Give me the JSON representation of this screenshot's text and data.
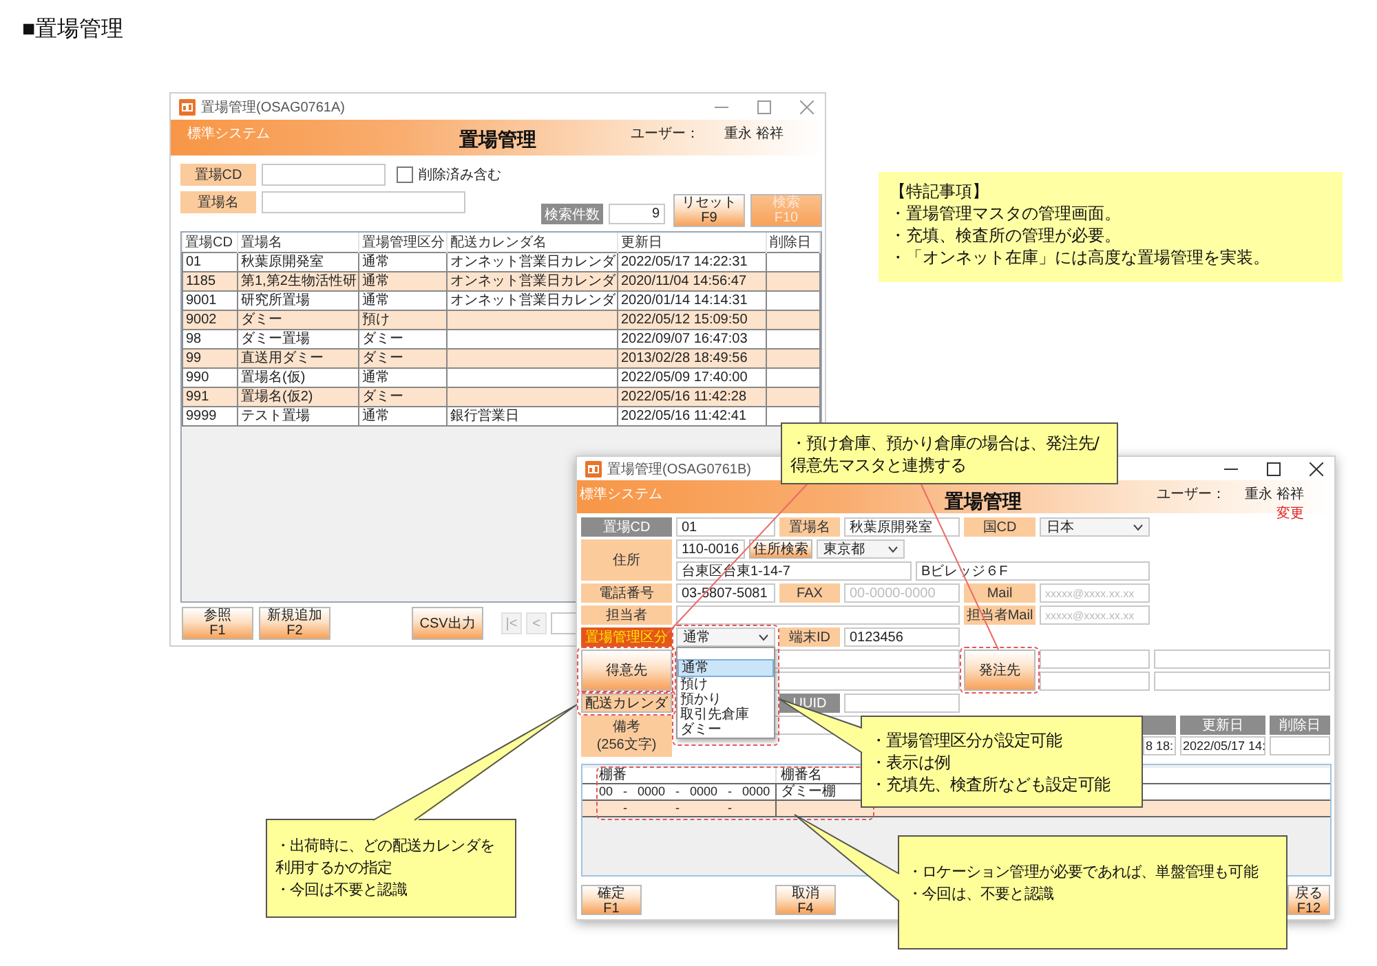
{
  "page_title": "■置場管理",
  "list_window": {
    "title": "置場管理(OSAG0761A)",
    "system": "標準システム",
    "heading": "置場管理",
    "user_label": "ユーザー：",
    "user_name": "重永 裕祥",
    "search_fields": [
      {
        "label": "置場CD"
      },
      {
        "label": "置場名"
      }
    ],
    "include_deleted": {
      "label": "削除済み含む",
      "checked": false
    },
    "count": {
      "label": "検索件数",
      "value": "9"
    },
    "buttons": [
      {
        "label": "リセット",
        "key": "F9",
        "disabled": false
      },
      {
        "label": "検索",
        "key": "F10",
        "disabled": true
      }
    ],
    "table": {
      "columns": [
        "置場CD",
        "置場名",
        "置場管理区分",
        "配送カレンダ名",
        "更新日",
        "削除日"
      ],
      "rows": [
        {
          "cells": [
            "01",
            "秋葉原開発室",
            "通常",
            "オンネット営業日カレンダ",
            "2022/05/17 14:22:31",
            null
          ]
        },
        {
          "cells": [
            "1185",
            "第1,第2生物活性研",
            "通常",
            "オンネット営業日カレンダ",
            "2020/11/04 14:56:47",
            null
          ]
        },
        {
          "cells": [
            "9001",
            "研究所置場",
            "通常",
            "オンネット営業日カレンダ",
            "2020/01/14 14:14:31",
            null
          ]
        },
        {
          "cells": [
            "9002",
            "ダミー",
            "預け",
            null,
            "2022/05/12 15:09:50",
            null
          ]
        },
        {
          "cells": [
            "98",
            "ダミー置場",
            "ダミー",
            null,
            "2022/09/07 16:47:03",
            null
          ]
        },
        {
          "cells": [
            "99",
            "直送用ダミー",
            "ダミー",
            null,
            "2013/02/28 18:49:56",
            null
          ]
        },
        {
          "cells": [
            "990",
            "置場名(仮)",
            "通常",
            null,
            "2022/05/09 17:40:00",
            null
          ]
        },
        {
          "cells": [
            "991",
            "置場名(仮2)",
            "ダミー",
            null,
            "2022/05/16 11:42:28",
            null
          ]
        },
        {
          "cells": [
            "9999",
            "テスト置場",
            "通常",
            "銀行営業日",
            "2022/05/16 11:42:41",
            null
          ]
        }
      ]
    },
    "footer_buttons": [
      {
        "label": "参照",
        "key": "F1"
      },
      {
        "label": "新規追加",
        "key": "F2"
      },
      {
        "label": "CSV出力"
      }
    ],
    "pager": [
      "|<",
      "<"
    ]
  },
  "detail_window": {
    "title": "置場管理(OSAG0761B)",
    "system": "標準システム",
    "heading": "置場管理",
    "user_label": "ユーザー：",
    "user_name": "重永 裕祥",
    "mode": "変更",
    "code": {
      "label": "置場CD",
      "value": "01"
    },
    "name": {
      "label": "置場名",
      "value": "秋葉原開発室"
    },
    "country": {
      "label": "国CD",
      "value": "日本"
    },
    "address": {
      "label": "住所",
      "postal": "110-0016",
      "search_button": "住所検索",
      "prefecture": "東京都",
      "line1": "台東区台東1-14-7",
      "line2": "Bビレッジ６F"
    },
    "phone": {
      "label": "電話番号",
      "value": "03-5807-5081"
    },
    "fax": {
      "label": "FAX",
      "placeholder": "00-0000-0000"
    },
    "mail": {
      "label": "Mail",
      "placeholder": "xxxxx@xxxx.xx.xx"
    },
    "contact": {
      "label": "担当者"
    },
    "contact_mail": {
      "label": "担当者Mail",
      "placeholder": "xxxxx@xxxx.xx.xx"
    },
    "location_type": {
      "label": "置場管理区分",
      "value": "通常",
      "expanded": true,
      "options": [
        {
          "label": "通常",
          "selected": true
        },
        {
          "label": "預け",
          "selected": false
        },
        {
          "label": "預かり",
          "selected": false
        },
        {
          "label": "取引先倉庫",
          "selected": false
        },
        {
          "label": "ダミー",
          "selected": false
        }
      ]
    },
    "terminal": {
      "label": "端末ID",
      "value": "0123456"
    },
    "customer_button": "得意先",
    "supplier_button": "発注先",
    "calendar_button": "配送カレンダ",
    "uuid": {
      "label": "UUID"
    },
    "remarks": {
      "label": [
        "備考",
        "(256文字)"
      ]
    },
    "dates": [
      {
        "value": "8 18:"
      },
      {
        "header": "更新日",
        "value": "2022/05/17 14:"
      },
      {
        "header": "削除日"
      }
    ],
    "shelves": {
      "columns": [
        "棚番",
        "棚番名"
      ],
      "rows": [
        {
          "code": "00   -   0000   -   0000   -   0000",
          "name": "ダミー棚",
          "selected": false
        },
        {
          "code": "       -              -              -",
          "selected": true
        }
      ]
    },
    "buttons": [
      {
        "label": "確定",
        "key": "F1"
      },
      {
        "label": "取消",
        "key": "F4"
      },
      {
        "label": "戻る",
        "key": "F12"
      }
    ]
  },
  "note": {
    "title": "【特記事項】",
    "lines": [
      "・置場管理マスタの管理画面。",
      "・充填、検査所の管理が必要。",
      "・「オンネット在庫」には高度な置場管理を実装。"
    ]
  },
  "callouts": [
    {
      "items": [
        "・預け倉庫、預かり倉庫の場合は、発注先/得意先マスタと連携する"
      ]
    },
    {
      "items": [
        "・置場管理区分が設定可能",
        "・表示は例",
        "・充填先、検査所なども設定可能"
      ]
    },
    {
      "items": [
        "・出荷時に、どの配送カレンダを利用するかの指定",
        "・今回は不要と認識"
      ]
    },
    {
      "items": [
        "・ロケーション管理が必要であれば、単盤管理も可能",
        "・今回は、不要と認識"
      ]
    }
  ]
}
